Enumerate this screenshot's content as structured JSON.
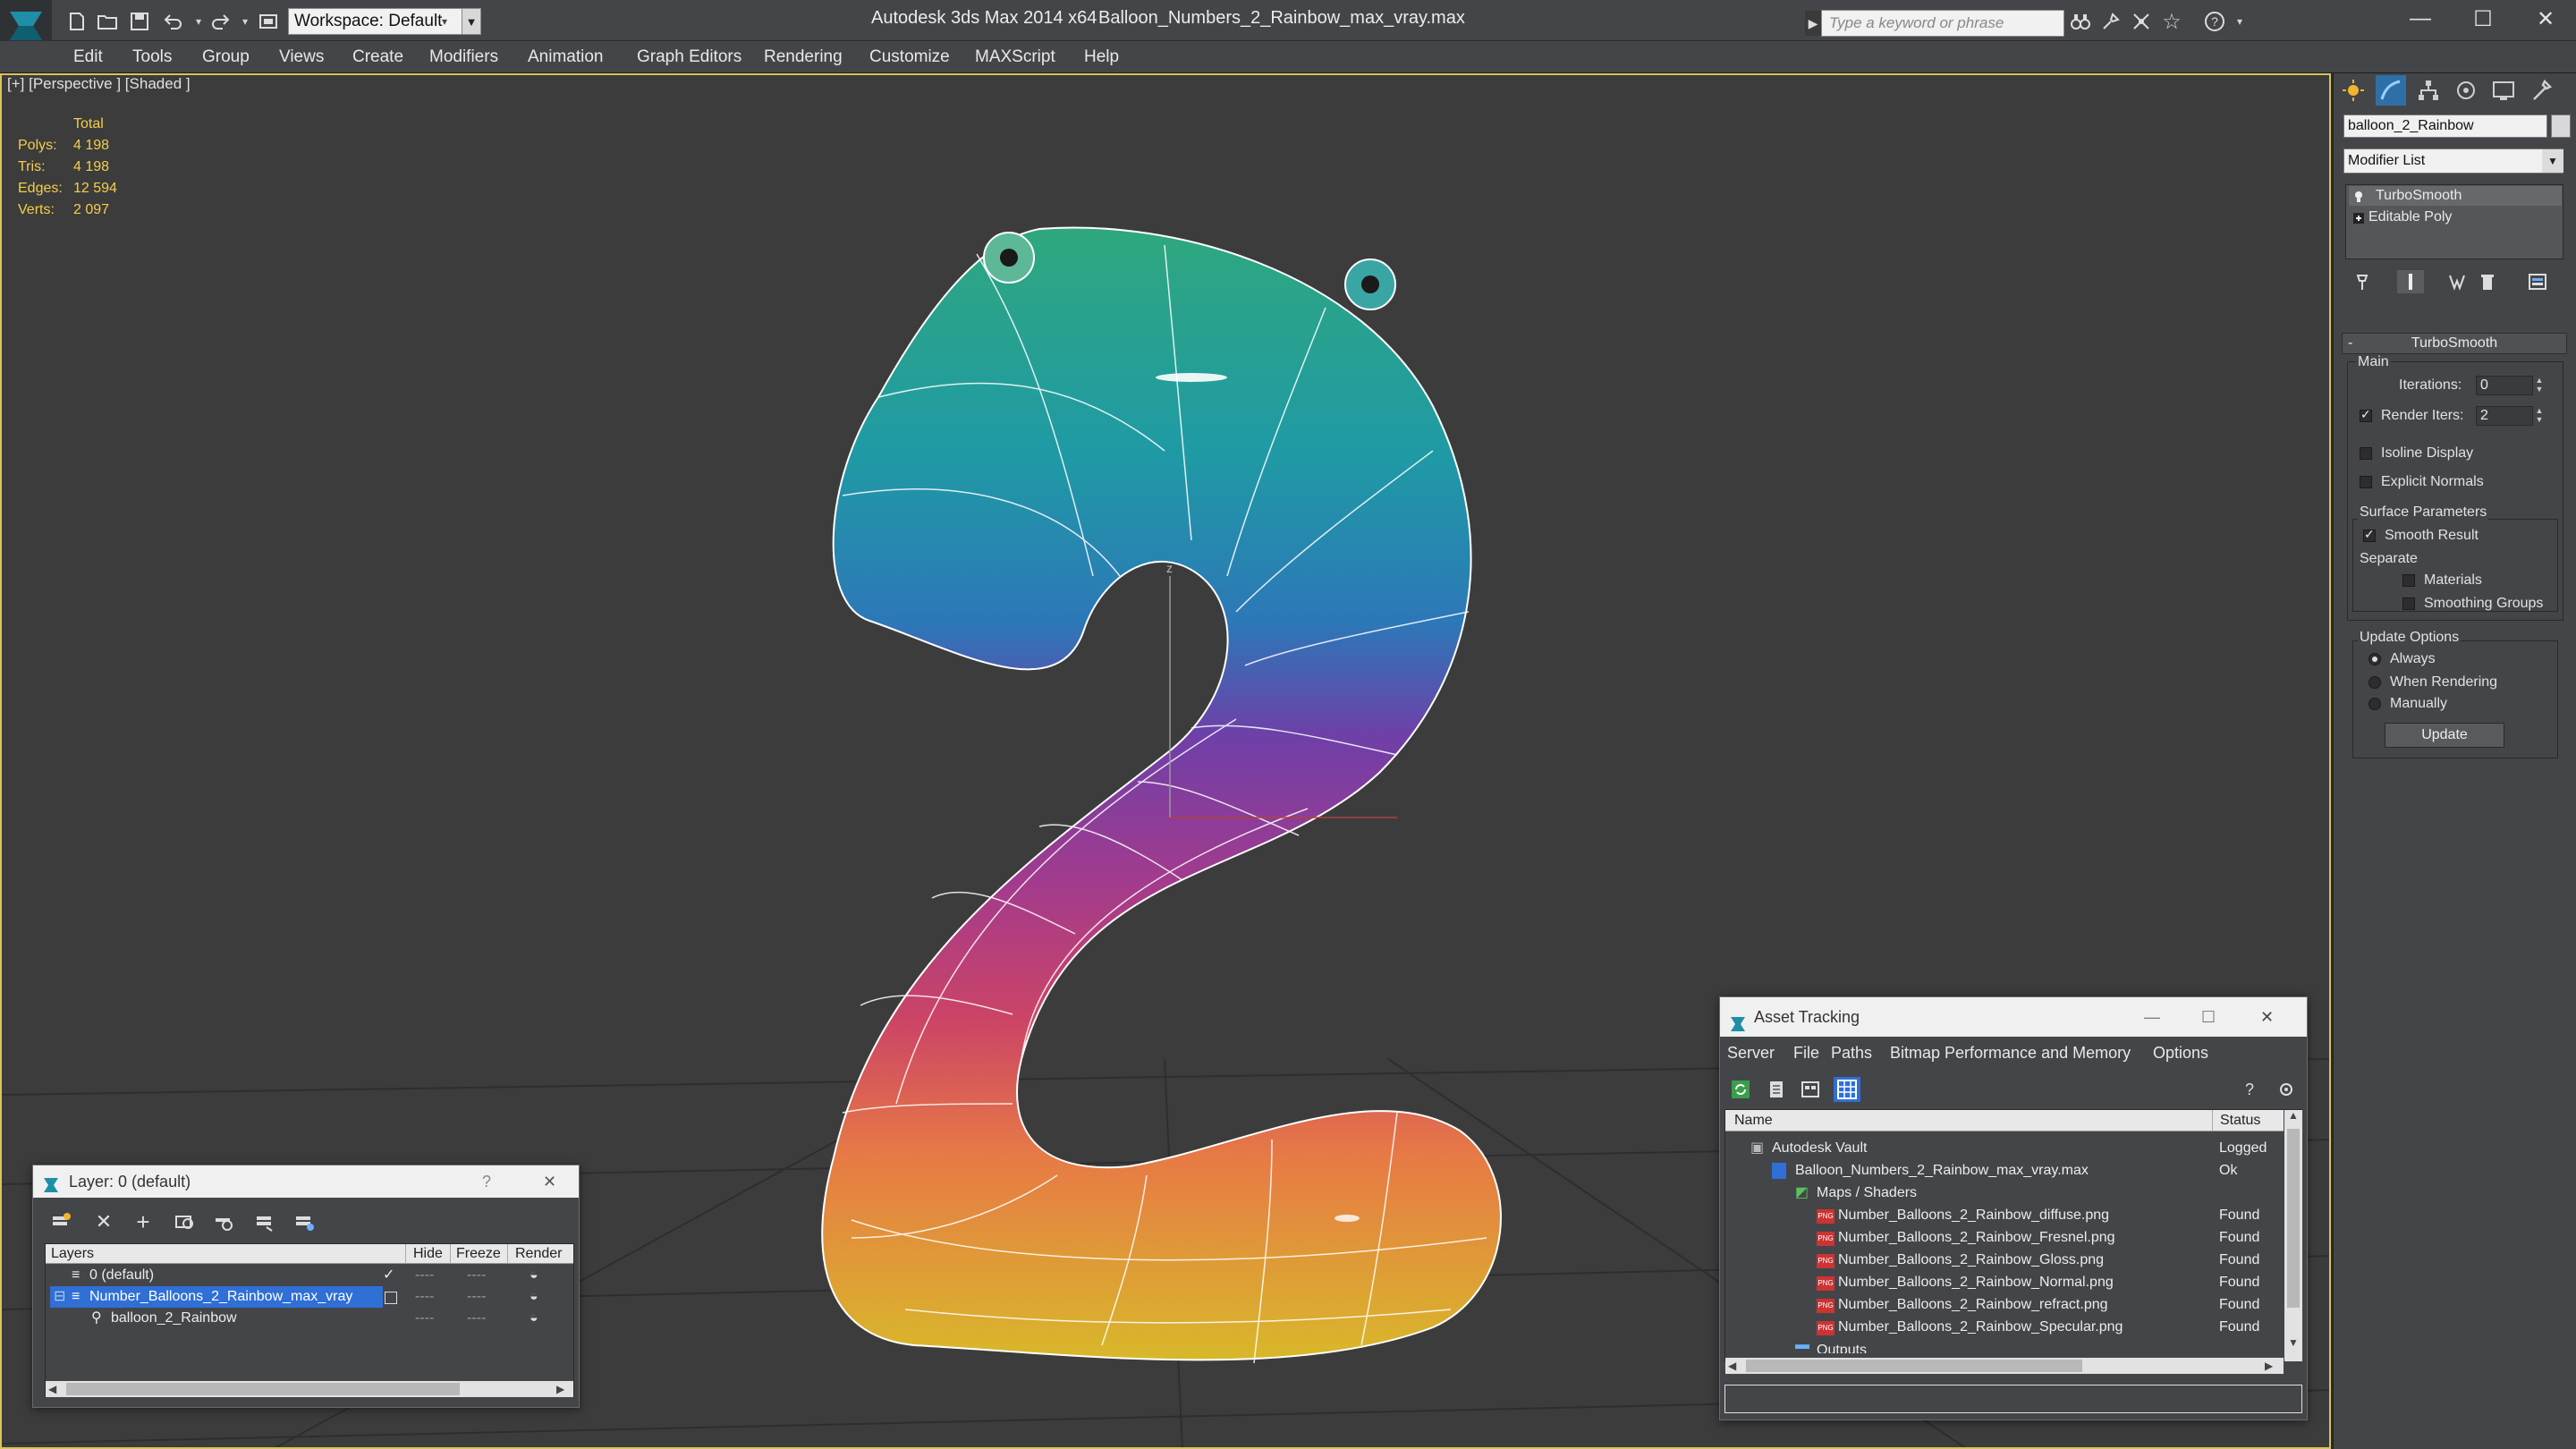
{
  "titlebar": {
    "workspace_label": "Workspace: Default",
    "app_title": "Autodesk 3ds Max  2014 x64",
    "file_title": "Balloon_Numbers_2_Rainbow_max_vray.max",
    "search_placeholder": "Type a keyword or phrase"
  },
  "menu": [
    "Edit",
    "Tools",
    "Group",
    "Views",
    "Create",
    "Modifiers",
    "Animation",
    "Graph Editors",
    "Rendering",
    "Customize",
    "MAXScript",
    "Help"
  ],
  "viewport": {
    "label": "[+] [Perspective ] [Shaded ]",
    "stats_header": "Total",
    "stats": [
      {
        "label": "Polys:",
        "value": "4 198"
      },
      {
        "label": "Tris:",
        "value": "4 198"
      },
      {
        "label": "Edges:",
        "value": "12 594"
      },
      {
        "label": "Verts:",
        "value": "2 097"
      }
    ],
    "gizmo_label": "z"
  },
  "command_panel": {
    "object_name": "balloon_2_Rainbow",
    "modifier_list": "Modifier List",
    "stack": [
      "TurboSmooth",
      "Editable Poly"
    ],
    "rollout_title": "TurboSmooth",
    "main_label": "Main",
    "iterations_label": "Iterations:",
    "iterations_value": "0",
    "render_iters_label": "Render Iters:",
    "render_iters_value": "2",
    "render_iters_checked": true,
    "isoline_label": "Isoline Display",
    "explicit_normals_label": "Explicit Normals",
    "surface_params_label": "Surface Parameters",
    "smooth_result_label": "Smooth Result",
    "smooth_result_checked": true,
    "separate_label": "Separate",
    "materials_label": "Materials",
    "smoothing_groups_label": "Smoothing Groups",
    "update_options_label": "Update Options",
    "update_always": "Always",
    "update_when_rendering": "When Rendering",
    "update_manually": "Manually",
    "update_button": "Update"
  },
  "layer_window": {
    "title": "Layer: 0 (default)",
    "help": "?",
    "columns": [
      "Layers",
      "Hide",
      "Freeze",
      "Render"
    ],
    "rows": [
      {
        "name": "0 (default)",
        "selected": false
      },
      {
        "name": "Number_Balloons_2_Rainbow_max_vray",
        "selected": true
      },
      {
        "name": "balloon_2_Rainbow",
        "selected": false
      }
    ]
  },
  "asset_window": {
    "title": "Asset Tracking",
    "menu": [
      "Server",
      "File",
      "Paths",
      "Bitmap Performance and Memory",
      "Options"
    ],
    "columns": [
      "Name",
      "Status"
    ],
    "rows": [
      {
        "name": "Autodesk Vault",
        "status": "Logged"
      },
      {
        "name": "Balloon_Numbers_2_Rainbow_max_vray.max",
        "status": "Ok"
      },
      {
        "name": "Maps / Shaders",
        "status": ""
      },
      {
        "name": "Number_Balloons_2_Rainbow_diffuse.png",
        "status": "Found"
      },
      {
        "name": "Number_Balloons_2_Rainbow_Fresnel.png",
        "status": "Found"
      },
      {
        "name": "Number_Balloons_2_Rainbow_Gloss.png",
        "status": "Found"
      },
      {
        "name": "Number_Balloons_2_Rainbow_Normal.png",
        "status": "Found"
      },
      {
        "name": "Number_Balloons_2_Rainbow_refract.png",
        "status": "Found"
      },
      {
        "name": "Number_Balloons_2_Rainbow_Specular.png",
        "status": "Found"
      },
      {
        "name": "Outputs",
        "status": ""
      }
    ],
    "file_icon_label": "PNG"
  },
  "colors": {
    "viewport_bg": "#3c3c3c",
    "active_border": "#d7c45a",
    "stats_text": "#f2cf4a",
    "selection": "#2f6fd6"
  }
}
